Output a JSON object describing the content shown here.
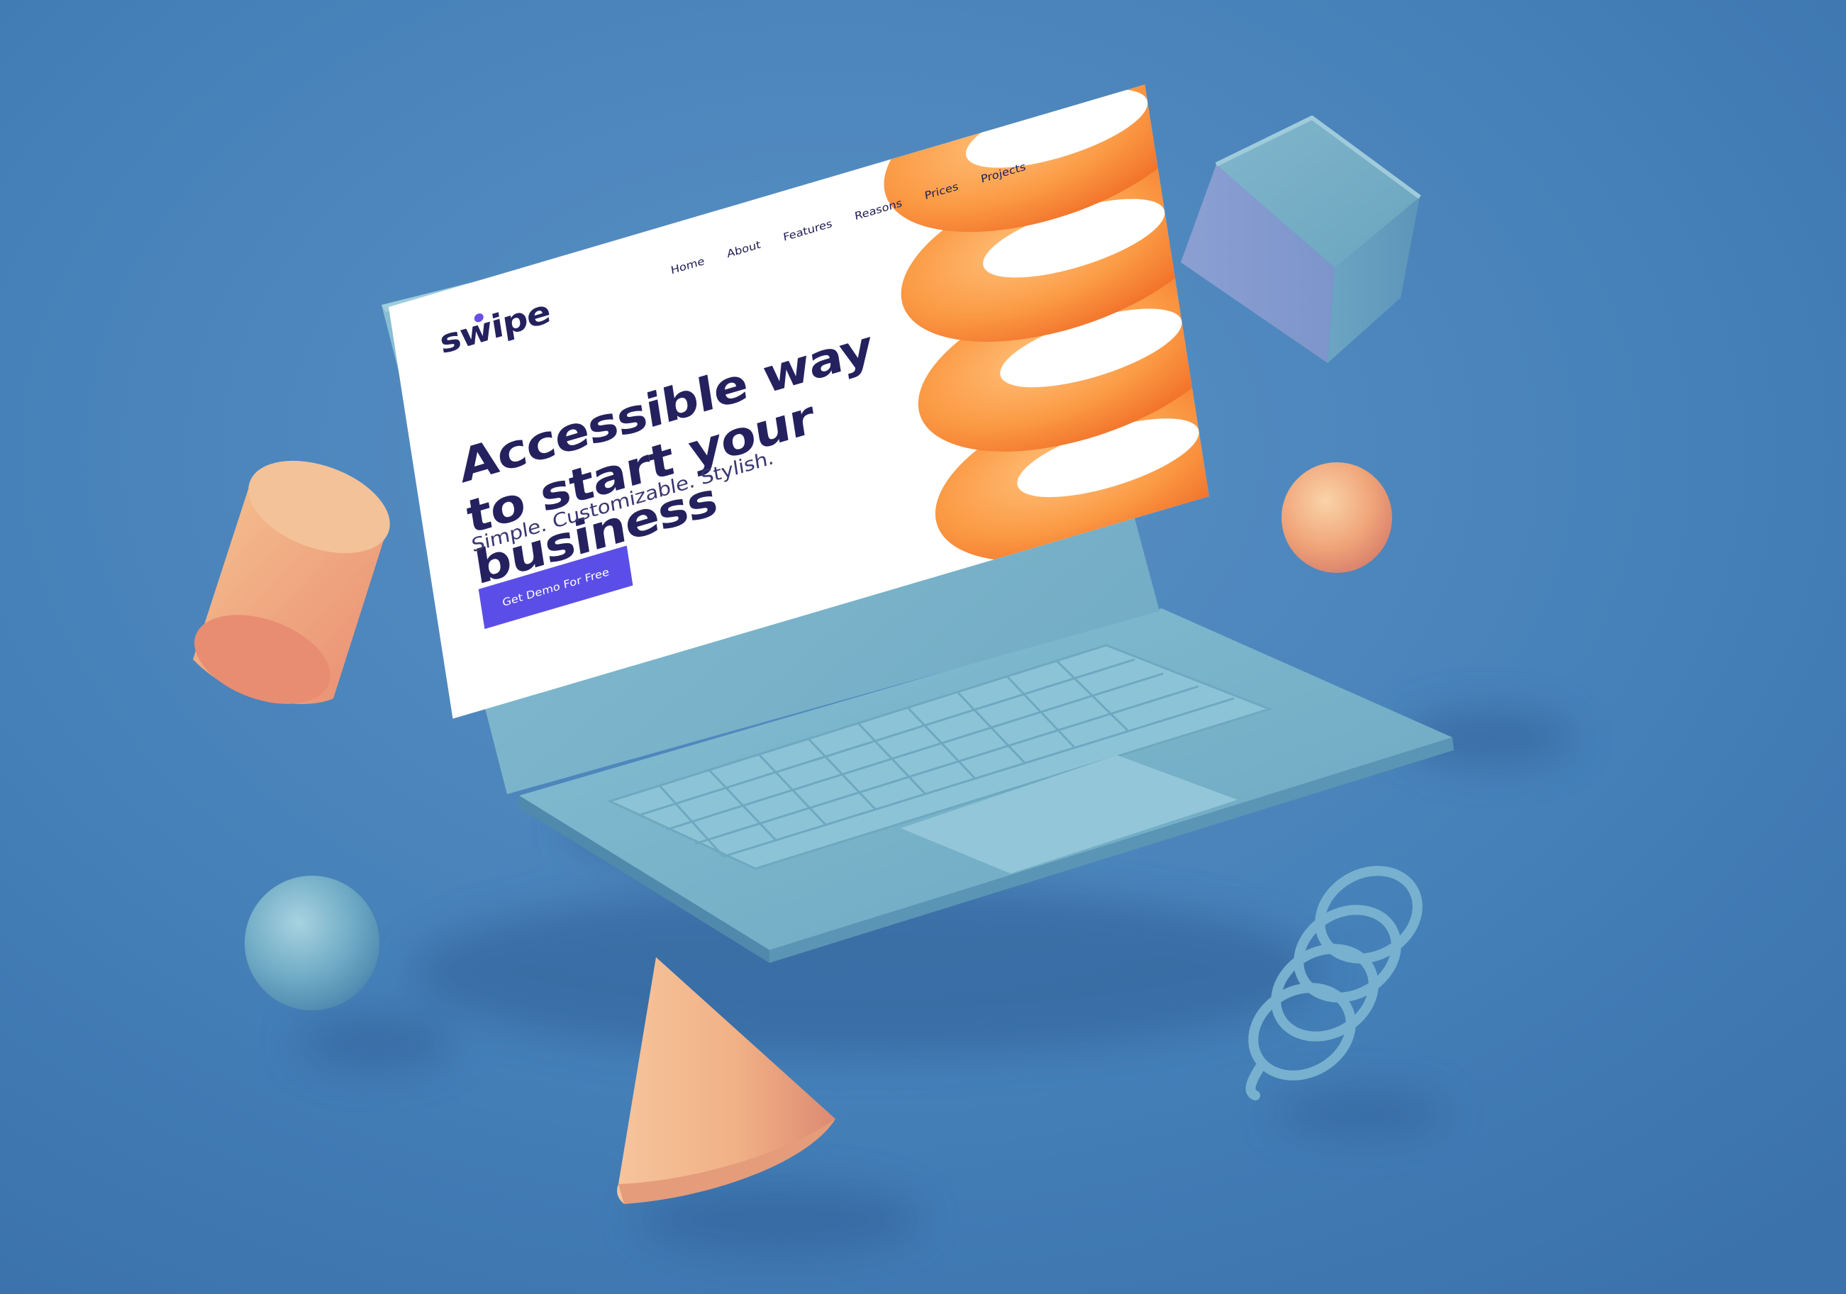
{
  "site": {
    "brand": "swipe",
    "nav": {
      "home": "Home",
      "about": "About",
      "features": "Features",
      "reasons": "Reasons",
      "prices": "Prices",
      "projects": "Projects"
    },
    "hero": {
      "title": "Accessible way to start your business",
      "subtitle": "Simple. Customizable. Stylish.",
      "cta_label": "Get Demo For Free"
    }
  },
  "colors": {
    "background": "#4a84b9",
    "laptop_body": "#74b1c8",
    "accent_orange": "#f79040",
    "shape_peach": "#f0b482",
    "brand_navy": "#24215e",
    "cta_purple": "#5b4ee8"
  },
  "decor": {
    "objects": [
      "cube",
      "cylinder",
      "orange-sphere",
      "blue-sphere",
      "cone",
      "spring"
    ]
  }
}
